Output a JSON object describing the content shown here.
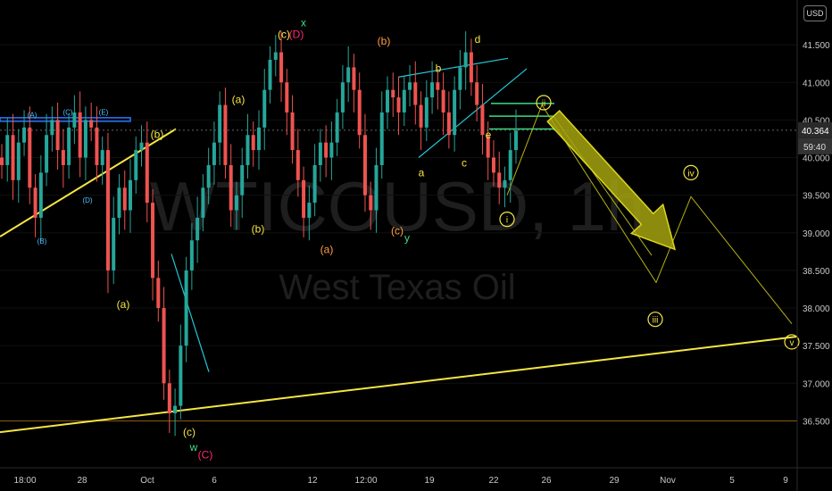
{
  "chart_data": {
    "type": "line",
    "currency": "USD",
    "watermark_symbol": "WTICOUSD, 1h",
    "watermark_name": "West Texas Oil",
    "y_ticks": [
      "41.500",
      "41.000",
      "40.500",
      "40.000",
      "39.500",
      "39.000",
      "38.500",
      "38.000",
      "37.500",
      "37.000",
      "36.500"
    ],
    "x_ticks": [
      "18:00",
      "28",
      "Oct",
      "6",
      "12",
      "12:00",
      "19",
      "22",
      "26",
      "29",
      "Nov",
      "5",
      "9"
    ],
    "ylim": [
      35.9,
      42.0
    ],
    "last_price": "40.364",
    "countdown": "59:40",
    "price_series": [
      39.9,
      40.3,
      39.7,
      40.2,
      40.4,
      39.6,
      39.2,
      39.8,
      40.3,
      40.5,
      40.1,
      39.9,
      40.4,
      40.6,
      40.0,
      40.5,
      40.4,
      39.9,
      40.1,
      38.5,
      39.2,
      39.6,
      39.3,
      39.7,
      40.1,
      40.2,
      39.4,
      38.4,
      38.0,
      37.0,
      36.6,
      36.7,
      37.5,
      38.5,
      38.9,
      39.2,
      39.6,
      39.9,
      40.2,
      40.7,
      39.9,
      39.3,
      39.5,
      39.9,
      40.3,
      40.1,
      40.4,
      40.9,
      41.3,
      41.4,
      41.0,
      40.6,
      40.1,
      39.7,
      39.2,
      39.4,
      39.9,
      40.2,
      40.0,
      40.2,
      40.6,
      41.0,
      41.2,
      40.9,
      40.3,
      39.5,
      39.3,
      39.9,
      40.6,
      40.9,
      40.8,
      40.6,
      40.9,
      41.0,
      40.7,
      40.4,
      40.8,
      41.0,
      40.9,
      40.6,
      40.3,
      40.9,
      41.2,
      41.4,
      41.0,
      40.7,
      40.3,
      40.0,
      39.8,
      39.6,
      39.7,
      40.1,
      40.36
    ],
    "labels": [
      {
        "text": "(A)",
        "color": "#4dc3ff"
      },
      {
        "text": "(C)",
        "color": "#4dc3ff"
      },
      {
        "text": "(E)",
        "color": "#4dc3ff"
      },
      {
        "text": "(B)",
        "color": "#4dc3ff"
      },
      {
        "text": "(D)",
        "color": "#4dc3ff"
      },
      {
        "text": "(b)",
        "color": "#f5e642"
      },
      {
        "text": "(a)",
        "color": "#f5e642"
      },
      {
        "text": "(a)",
        "color": "#f5e642"
      },
      {
        "text": "(b)",
        "color": "#f5e642"
      },
      {
        "text": "(c)",
        "color": "#f5e642"
      },
      {
        "text": "(D)",
        "color": "#ff2a6d"
      },
      {
        "text": "x",
        "color": "#3ddc84"
      },
      {
        "text": "(b)",
        "color": "#ff9f43"
      },
      {
        "text": "(a)",
        "color": "#ff9f43"
      },
      {
        "text": "(c)",
        "color": "#ff9f43"
      },
      {
        "text": "y",
        "color": "#3ddc84"
      },
      {
        "text": "b",
        "color": "#f5e642"
      },
      {
        "text": "d",
        "color": "#f5e642"
      },
      {
        "text": "a",
        "color": "#f5e642"
      },
      {
        "text": "c",
        "color": "#f5e642"
      },
      {
        "text": "e",
        "color": "#f5e642"
      },
      {
        "text": "(c)",
        "color": "#f5e642"
      },
      {
        "text": "w",
        "color": "#3ddc84"
      },
      {
        "text": "(C)",
        "color": "#ff2a6d"
      }
    ],
    "circle_labels": [
      "i",
      "ii",
      "iii",
      "iv",
      "v"
    ],
    "colors": {
      "up": "#26a69a",
      "down": "#ef5350",
      "trend": "#f5e642",
      "channel": "#26c6da",
      "level": "#3ddc84",
      "box": "#2979ff",
      "projection": "#b5b214"
    }
  }
}
